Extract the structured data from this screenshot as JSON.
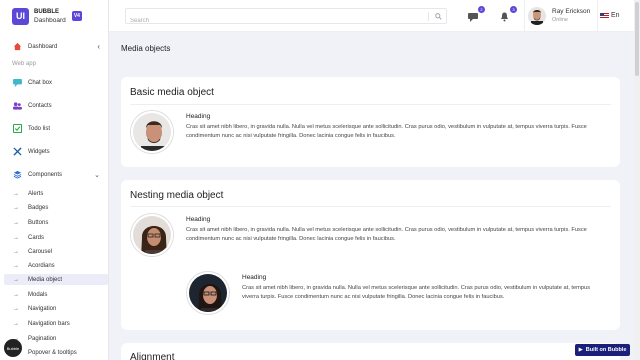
{
  "brand": {
    "logo": "UI",
    "name": "BUBBLE",
    "sub": "Dashboard",
    "version": "V4"
  },
  "sidebar": {
    "dashboard": "Dashboard",
    "section": "Web app",
    "items": [
      "Chat box",
      "Contacts",
      "Todo list",
      "Widgets",
      "Components"
    ],
    "components": [
      "Alerts",
      "Badges",
      "Buttons",
      "Cards",
      "Carousel",
      "Acordians",
      "Media object",
      "Modals",
      "Navigation",
      "Navigation bars",
      "Pagination",
      "Popover & tooltips"
    ],
    "active": "Media object"
  },
  "topbar": {
    "search_placeholder": "Search",
    "messages_count": "2",
    "notifications_count": "3",
    "user_name": "Ray Erickson",
    "user_status": "Online",
    "language": "En"
  },
  "page": {
    "title": "Media objects"
  },
  "basic": {
    "title": "Basic media object",
    "heading": "Heading",
    "text": "Cras sit amet nibh libero, in gravida nulla. Nulla vel metus scelerisque ante sollicitudin. Cras purus odio, vestibulum in vulputate at, tempus viverra turpis. Fusce condimentum nunc ac nisi vulputate fringilla. Donec lacinia congue felis in faucibus."
  },
  "nesting": {
    "title": "Nesting media object",
    "heading": "Heading",
    "text": "Cras sit amet nibh libero, in gravida nulla. Nulla vel metus scelerisque ante sollicitudin. Cras purus odio, vestibulum in vulputate at, tempus viverra turpis. Fusce condimentum nunc ac nisi vulputate fringilla. Donec lacinia congue felis in faucibus.",
    "nested_heading": "Heading",
    "nested_text": "Cras sit amet nibh libero, in gravida nulla. Nulla vel metus scelerisque ante sollicitudin. Cras purus odio, vestibulum in vulputate at, tempus viverra turpis. Fusce condimentum nunc ac nisi vulputate fringilla. Donec lacinia congue felis in faucibus."
  },
  "alignment": {
    "title": "Alignment"
  },
  "footer": {
    "built_label": "Built on Bubble",
    "circle_label": "Bubble"
  },
  "colors": {
    "accent": "#5b48d9",
    "built": "#1b1f7a",
    "dashboard_icon": "#e64a3b"
  }
}
